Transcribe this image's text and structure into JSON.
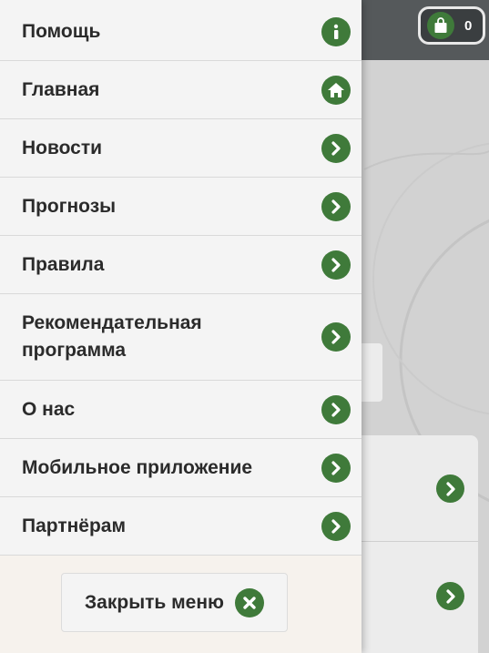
{
  "header": {
    "cart_count": "0"
  },
  "menu": {
    "items": [
      {
        "label": "Помощь",
        "icon": "info-icon"
      },
      {
        "label": "Главная",
        "icon": "home-icon"
      },
      {
        "label": "Новости",
        "icon": "chevron-right-icon"
      },
      {
        "label": "Прогнозы",
        "icon": "chevron-right-icon"
      },
      {
        "label": "Правила",
        "icon": "chevron-right-icon"
      },
      {
        "label": "Рекомендательная программа",
        "icon": "chevron-right-icon"
      },
      {
        "label": "О нас",
        "icon": "chevron-right-icon"
      },
      {
        "label": "Мобильное приложение",
        "icon": "chevron-right-icon"
      },
      {
        "label": "Партнёрам",
        "icon": "chevron-right-icon"
      }
    ],
    "close_label": "Закрыть меню"
  },
  "colors": {
    "accent_green": "#3f7a3a",
    "header_bg": "#55595b",
    "drawer_bg": "#f4f4f4"
  }
}
